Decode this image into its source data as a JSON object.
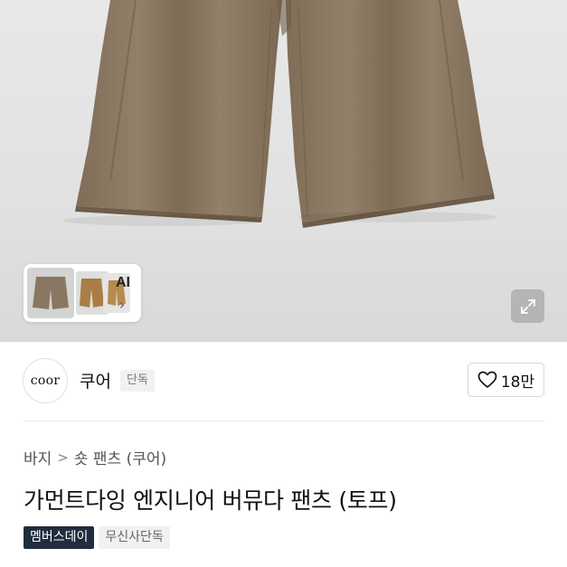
{
  "gallery": {
    "ai_label": "AI",
    "ai_chevron": "›",
    "expand_icon": "expand-icon"
  },
  "brand": {
    "logo_text": "coor",
    "name": "쿠어",
    "badge": "단독",
    "like_count": "18만",
    "like_icon": "heart-icon"
  },
  "breadcrumb": {
    "category": "바지",
    "separator": ">",
    "subcategory": "숏 팬츠 (쿠어)"
  },
  "product": {
    "title": "가먼트다잉 엔지니어 버뮤다 팬츠 (토프)"
  },
  "tags": [
    {
      "label": "멤버스데이"
    },
    {
      "label": "무신사단독"
    }
  ],
  "colors": {
    "pants": "#8a7761",
    "tag_dark": "#1f2d3d"
  }
}
